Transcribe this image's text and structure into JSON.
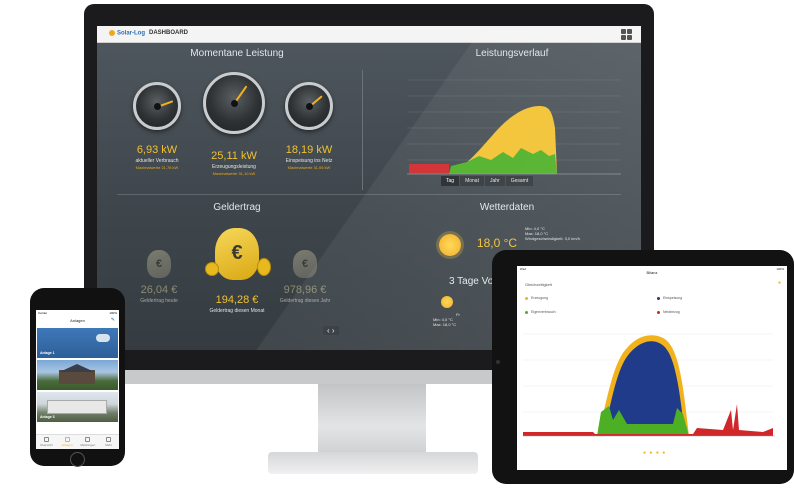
{
  "monitor": {
    "logo": "Solar-Log",
    "nav_label": "DASHBOARD",
    "sections": {
      "power_title": "Momentane Leistung",
      "history_title": "Leistungsverlauf",
      "yield_title": "Geldertrag",
      "weather_title": "Wetterdaten",
      "forecast_title": "3 Tage Vo"
    },
    "gauges": [
      {
        "value": "6,93 kW",
        "label": "aktueller Verbrauch",
        "sublabel": "Maximalwerte 21,78 kW"
      },
      {
        "value": "25,11 kW",
        "label": "Erzeugungsleistung",
        "sublabel": "Maximalwerte 31,10 kW"
      },
      {
        "value": "18,19 kW",
        "label": "Einspeisung ins Netz",
        "sublabel": "Maximalwerte 31,06 kW"
      }
    ],
    "chart_tabs": [
      "Tag",
      "Monat",
      "Jahr",
      "Gesamt"
    ],
    "active_tab": "Tag",
    "money": [
      {
        "value": "26,04 €",
        "label": "Geldertrag heute"
      },
      {
        "value": "194,28 €",
        "label": "Geldertrag diesen Monat"
      },
      {
        "value": "978,96 €",
        "label": "Geldertrag dieses Jahr"
      }
    ],
    "bag_symbol": "€",
    "weather": {
      "temp": "18,0 °C",
      "min": "Min: 4,0 °C",
      "max": "Max: 18,0 °C",
      "wind": "Windgeschwindigkeit: 3,0 km/h"
    },
    "forecast": [
      {
        "day": "Fr",
        "min": "Min: 4,0 °C",
        "max": "Max: 18,0 °C"
      }
    ],
    "pager": "‹ ›",
    "colors": {
      "accent": "#f2c12e",
      "production": "#f2b21b",
      "consumption": "#4caf24",
      "grid": "#d0272b"
    }
  },
  "phone": {
    "status_left": "Carrier",
    "status_right": "100%",
    "title": "Anlagen",
    "edit_icon": "pencil-icon",
    "cards": [
      {
        "label": "Anlage 1"
      },
      {
        "label": ""
      },
      {
        "label": "Anlage 3"
      }
    ],
    "tabs": [
      "Übersicht",
      "Anlagen",
      "Meldungen",
      "Mehr"
    ]
  },
  "tablet": {
    "status_left": "iPad",
    "status_right": "100%",
    "title": "Bilanz",
    "subtitle": "Gleichzeitigkeit",
    "legend": [
      {
        "label": "Erzeugung",
        "color": "#f2b21b"
      },
      {
        "label": "Einspeisung",
        "color": "#1f3b8a"
      },
      {
        "label": "Eigenverbrauch",
        "color": "#4caf24"
      },
      {
        "label": "Netzbezug",
        "color": "#d0272b"
      }
    ],
    "dots": "● ● ● ●"
  }
}
